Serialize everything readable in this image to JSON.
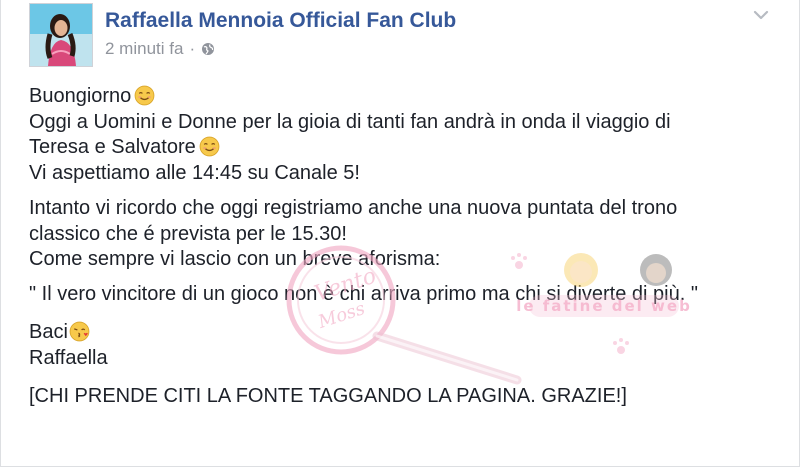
{
  "post": {
    "author": "Raffaella Mennoia Official Fan Club",
    "time": "2 minuti fa",
    "separator": "·",
    "avatar_icon": "profile-photo",
    "privacy_icon": "globe-icon",
    "menu_icon": "chevron-down-icon"
  },
  "content": {
    "line1": "Buongiorno",
    "line2": "Oggi a Uomini e Donne per la gioia di tanti fan andrà in onda il viaggio di",
    "line3": "Teresa e Salvatore",
    "line4": "Vi aspettiamo alle 14:45 su Canale 5!",
    "line5": "Intanto vi ricordo che oggi registriamo anche una nuova puntata del trono",
    "line6": "classico che é prevista per le 15.30!",
    "line7": "Come sempre vi lascio con un breve aforisma:",
    "line8": "\" Il vero vincitore di un gioco non è chi arriva primo ma chi si diverte di più. \"",
    "line9": "Baci",
    "line10": "Raffaella",
    "line11": "[CHI PRENDE CITI LA FONTE TAGGANDO LA PAGINA. GRAZIE!]"
  },
  "emojis": {
    "smile": "smiling-face-icon",
    "kiss": "kiss-face-icon"
  },
  "watermarks": {
    "left_text": "Vento della Moss",
    "right_text": "le fatine del web"
  },
  "colors": {
    "link": "#365899",
    "text": "#1d2129",
    "meta": "#90949c",
    "emoji": "#f7c94b"
  }
}
